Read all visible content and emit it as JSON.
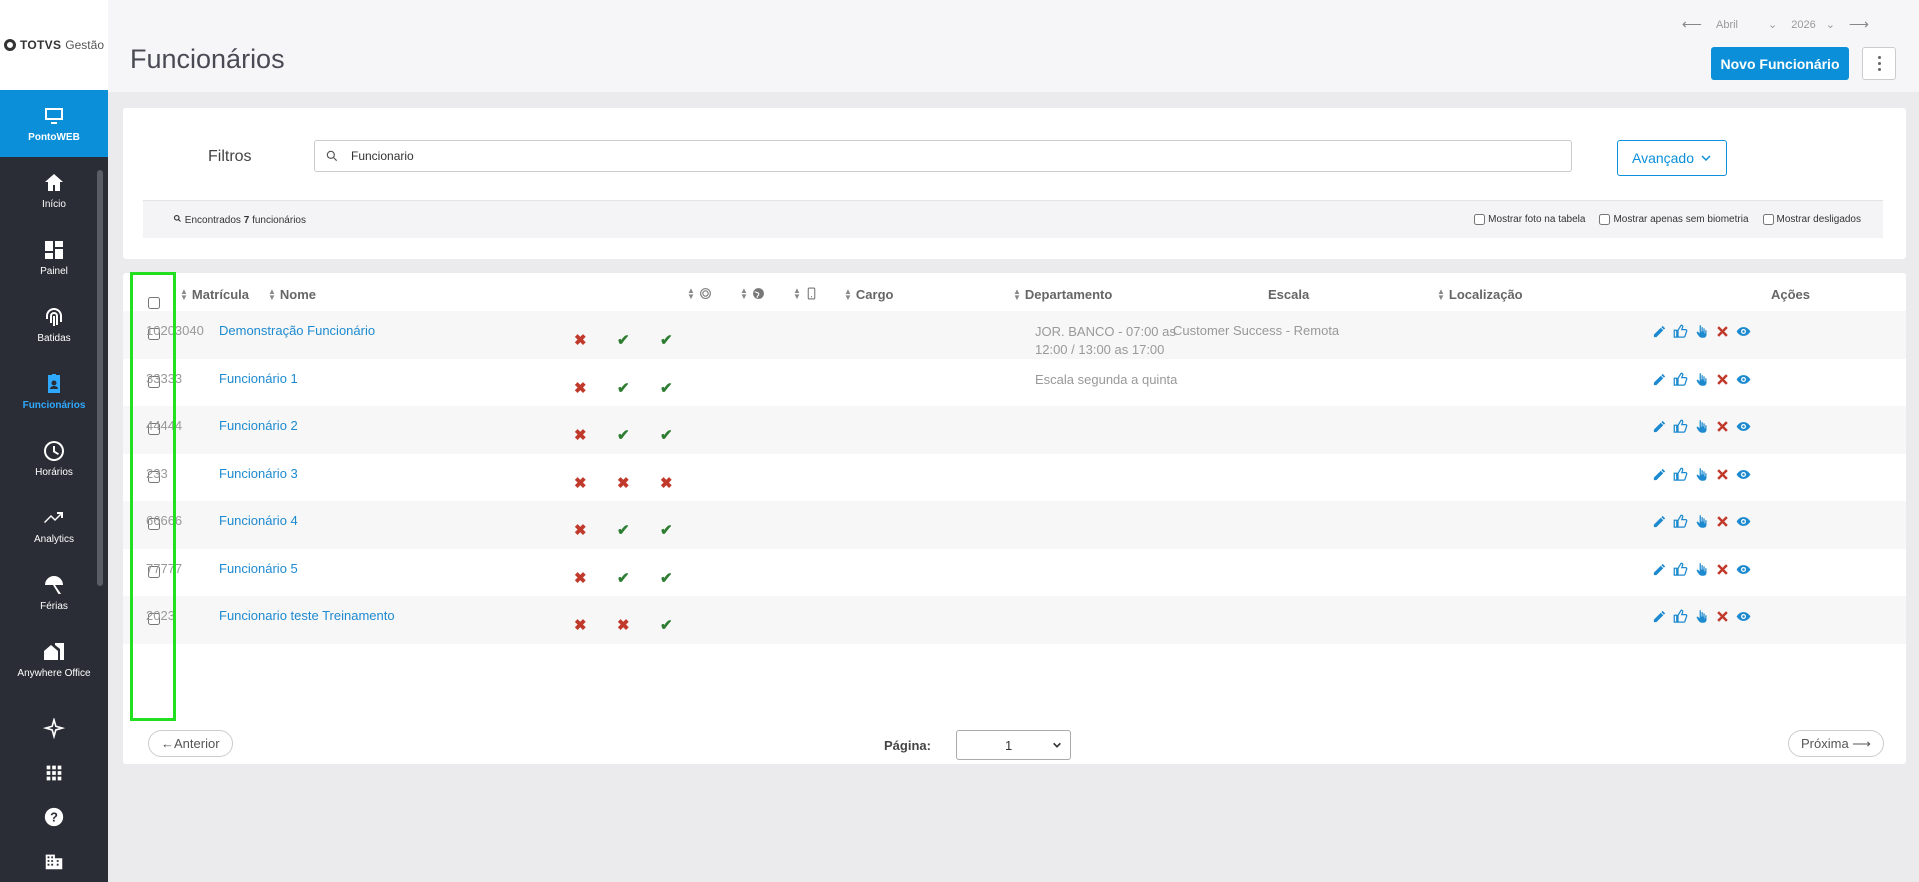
{
  "sidebar": {
    "logo_brand": "TOTVS",
    "logo_sub": "Gestão",
    "app_label": "PontoWEB",
    "items": [
      {
        "label": "Início",
        "icon": "home-icon"
      },
      {
        "label": "Painel",
        "icon": "dashboard-icon"
      },
      {
        "label": "Batidas",
        "icon": "fingerprint-icon"
      },
      {
        "label": "Funcionários",
        "icon": "badge-icon",
        "active": true
      },
      {
        "label": "Horários",
        "icon": "clock-icon"
      },
      {
        "label": "Analytics",
        "icon": "trending-icon"
      },
      {
        "label": "Férias",
        "icon": "beach-umbrella-icon"
      },
      {
        "label": "Anywhere Office",
        "icon": "home-work-icon"
      }
    ],
    "bottom_icons": [
      "sparkle-icon",
      "apps-grid-icon",
      "help-icon",
      "building-icon"
    ]
  },
  "header": {
    "title": "Funcionários",
    "month": "Abril",
    "year": "2026",
    "new_button": "Novo Funcionário"
  },
  "filters": {
    "label": "Filtros",
    "search_value": "Funcionario",
    "advanced_button": "Avançado",
    "found_prefix": "Encontrados",
    "found_count": "7",
    "found_suffix": "funcionários",
    "options": [
      "Mostrar foto na tabela",
      "Mostrar apenas sem biometria",
      "Mostrar desligados"
    ]
  },
  "table": {
    "headers": {
      "matricula": "Matrícula",
      "nome": "Nome",
      "cargo": "Cargo",
      "departamento": "Departamento",
      "escala": "Escala",
      "localizacao": "Localização",
      "acoes": "Ações"
    },
    "rows": [
      {
        "matricula": "10203040",
        "nome": "Demonstração Funcionário",
        "bio": false,
        "web": true,
        "mobile": true,
        "escala": "JOR. BANCO - 07:00 as 12:00 / 13:00 as 17:00",
        "localizacao": "Customer Success - Remota"
      },
      {
        "matricula": "33333",
        "nome": "Funcionário 1",
        "bio": false,
        "web": true,
        "mobile": true,
        "escala": "Escala segunda a quinta",
        "localizacao": ""
      },
      {
        "matricula": "44444",
        "nome": "Funcionário 2",
        "bio": false,
        "web": true,
        "mobile": true,
        "escala": "",
        "localizacao": ""
      },
      {
        "matricula": "233",
        "nome": "Funcionário 3",
        "bio": false,
        "web": false,
        "mobile": false,
        "escala": "",
        "localizacao": ""
      },
      {
        "matricula": "66666",
        "nome": "Funcionário 4",
        "bio": false,
        "web": true,
        "mobile": true,
        "escala": "",
        "localizacao": ""
      },
      {
        "matricula": "77777",
        "nome": "Funcionário 5",
        "bio": false,
        "web": true,
        "mobile": true,
        "escala": "",
        "localizacao": ""
      },
      {
        "matricula": "2023",
        "nome": "Funcionario teste Treinamento",
        "bio": false,
        "web": false,
        "mobile": true,
        "escala": "",
        "localizacao": ""
      }
    ]
  },
  "pager": {
    "prev": "←Anterior",
    "next": "Próxima ⟶",
    "label": "Página:",
    "current": "1"
  },
  "colors": {
    "primary": "#0b8fd8",
    "sidebar": "#2a2d35",
    "error": "#c0392b",
    "ok": "#2e7d32",
    "highlight": "#22e01f"
  }
}
